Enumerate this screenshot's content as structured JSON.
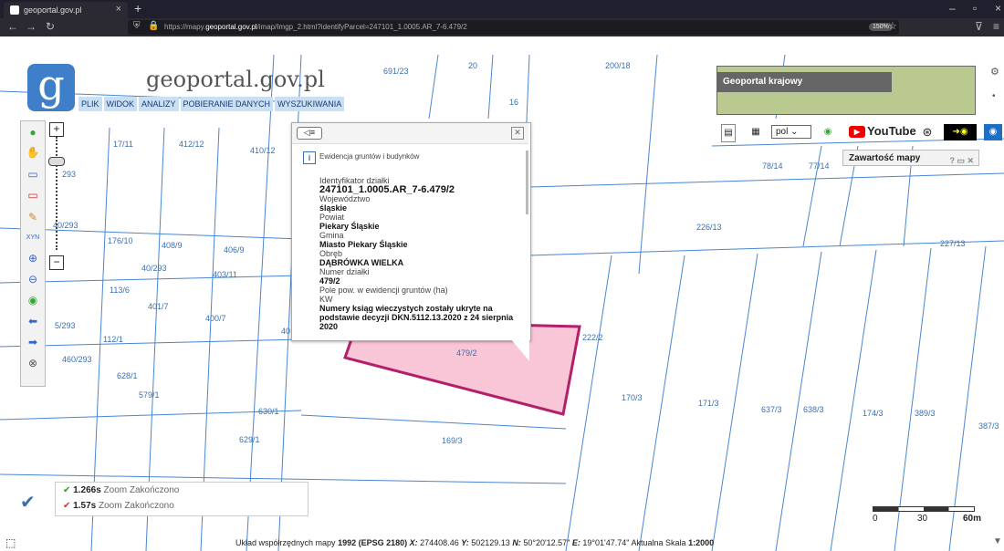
{
  "browser": {
    "tab_title": "geoportal.gov.pl",
    "tab_close": "×",
    "new_tab": "+",
    "url_prefix": "https://mapy.",
    "url_domain": "geoportal.gov.pl",
    "url_path": "/imap/Imgp_2.html?identifyParcel=247101_1.0005.AR_7-6.479/2",
    "zoom": "150%"
  },
  "header": {
    "site_title": "geoportal.gov.pl",
    "menu": [
      "PLIK",
      "WIDOK",
      "ANALIZY",
      "POBIERANIE DANYCH",
      "WYSZUKIWANIA"
    ]
  },
  "minimap": {
    "title": "Geoportal krajowy"
  },
  "toolbar_right": {
    "lang": "pol",
    "youtube": "YouTube"
  },
  "layers_panel": {
    "title": "Zawartość mapy",
    "buttons": "? ▭ ✕"
  },
  "popup": {
    "back": "◁≡",
    "close": "✕",
    "source": "Ewidencja gruntów i budynków",
    "fields": [
      {
        "label": "Identyfikator działki",
        "value": "247101_1.0005.AR_7-6.479/2"
      },
      {
        "label": "Województwo",
        "value": "śląskie"
      },
      {
        "label": "Powiat",
        "value": "Piekary Śląskie"
      },
      {
        "label": "Gmina",
        "value": "Miasto Piekary Śląskie"
      },
      {
        "label": "Obręb",
        "value": "DĄBRÓWKA WIELKA"
      },
      {
        "label": "Numer działki",
        "value": "479/2"
      },
      {
        "label": "Pole pow. w ewidencji gruntów (ha)",
        "value": ""
      },
      {
        "label": "KW",
        "value": "Numery ksiąg wieczystych zostały ukryte na podstawie decyzji DKN.5112.13.2020 z 24 sierpnia 2020"
      }
    ]
  },
  "parcels": [
    "691/23",
    "20",
    "200/18",
    "16",
    "17/11",
    "412/12",
    "410/12",
    "78/14",
    "77/14",
    "293",
    "226/13",
    "227/13",
    "40/293",
    "176/10",
    "408/9",
    "406/9",
    "40/293",
    "403/11",
    "113/6",
    "401/7",
    "400/7",
    "40",
    "222/2",
    "479/2",
    "5/293",
    "112/1",
    "460/293",
    "628/1",
    "579/1",
    "630/1",
    "170/3",
    "171/3",
    "637/3",
    "638/3",
    "174/3",
    "389/3",
    "387/3",
    "629/1",
    "169/3"
  ],
  "status": [
    {
      "time": "1.266s",
      "zoom": "Zoom",
      "state": "Zakończono",
      "color": "#2e9b2e"
    },
    {
      "time": "1.57s",
      "zoom": "Zoom",
      "state": "Zakończono",
      "color": "#d9342b"
    }
  ],
  "coords": {
    "system_label": "Układ współrzędnych mapy",
    "system": "1992 (EPSG 2180)",
    "x_label": "X:",
    "x": "274408.46",
    "y_label": "Y:",
    "y": "502129.13",
    "n_label": "N:",
    "n": "50°20'12.57\"",
    "e_label": "E:",
    "e": "19°01'47.74\"",
    "scale_label": "Aktualna Skala",
    "scale": "1:2000"
  },
  "scalebar": {
    "ticks": [
      "0",
      "30",
      "60m"
    ]
  }
}
